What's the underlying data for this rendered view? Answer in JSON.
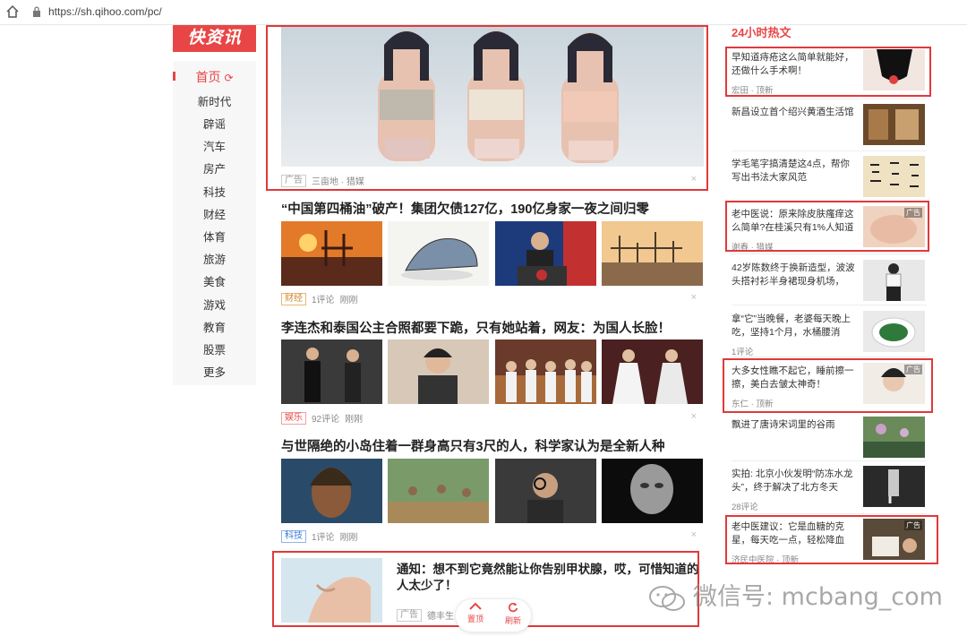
{
  "browser": {
    "url": "https://sh.qihoo.com/pc/"
  },
  "logo": {
    "text": "快资讯"
  },
  "nav": {
    "items": [
      "首页",
      "新时代",
      "辟谣",
      "汽车",
      "房产",
      "科技",
      "财经",
      "体育",
      "旅游",
      "美食",
      "游戏",
      "教育",
      "股票",
      "更多"
    ]
  },
  "feed": {
    "banner_ad": {
      "tag": "广告",
      "source": "三亩地 · 猎媒",
      "close": "×"
    },
    "articles": [
      {
        "title": "“中国第四桶油”破产！集团欠债127亿，190亿身家一夜之间归零",
        "tag": "财经",
        "comments": "1评论",
        "time": "刚刚",
        "close": "×"
      },
      {
        "title": "李连杰和泰国公主合照都要下跪，只有她站着，网友：为国人长脸！",
        "tag": "娱乐",
        "comments": "92评论",
        "time": "刚刚",
        "close": "×"
      },
      {
        "title": "与世隔绝的小岛住着一群身高只有3尺的人，科学家认为是全新人种",
        "tag": "科技",
        "comments": "1评论",
        "time": "刚刚",
        "close": "×"
      }
    ],
    "bottom_ad": {
      "title": "通知：想不到它竟然能让你告别甲状腺，哎，可惜知道的人太少了！",
      "tag": "广告",
      "source": "德丰生"
    }
  },
  "sidebar": {
    "title": "24小时热文",
    "items": [
      {
        "title": "早知道痔疮这么简单就能好，还做什么手术啊！",
        "meta": "宏田 · 顶新",
        "ad": ""
      },
      {
        "title": "新昌设立首个绍兴黄酒生活馆",
        "meta": "",
        "ad": ""
      },
      {
        "title": "学毛笔字搞清楚这4点，帮你写出书法大家风范",
        "meta": "",
        "ad": ""
      },
      {
        "title": "老中医说：原来除皮肤瘙痒这么简单?在桂溪只有1%人知道",
        "meta": "谢春 · 猎媒",
        "ad": "广告"
      },
      {
        "title": "42岁陈数终于换新造型，波波头搭衬衫半身裙现身机场，",
        "meta": "",
        "ad": ""
      },
      {
        "title": "拿“它”当晚餐，老婆每天晚上吃，坚持1个月，水桶腰消",
        "meta": "1评论",
        "ad": ""
      },
      {
        "title": "大多女性瞧不起它，睡前擦一擦，美白去皱太神奇！",
        "meta": "东仁 · 顶新",
        "ad": "广告"
      },
      {
        "title": "飘进了唐诗宋词里的谷雨",
        "meta": "",
        "ad": ""
      },
      {
        "title": "实拍: 北京小伙发明“防冻水龙头”，终于解决了北方冬天",
        "meta": "28评论",
        "ad": ""
      },
      {
        "title": "老中医建议：它是血糖的克星，每天吃一点，轻松降血",
        "meta": "济民中医院 · 顶新",
        "ad": "广告"
      }
    ]
  },
  "float_buttons": {
    "top": "置顶",
    "refresh": "刷新"
  },
  "watermark": {
    "text": "微信号: mcbang_com"
  }
}
